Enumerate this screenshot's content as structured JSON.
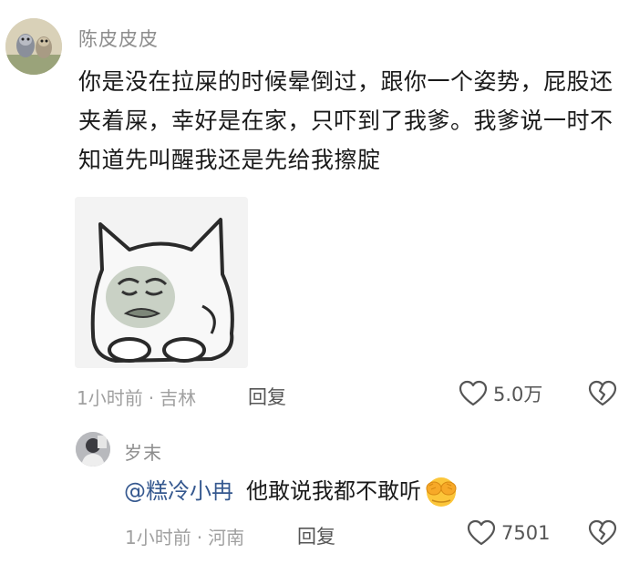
{
  "comment": {
    "username": "陈皮皮皮",
    "text": "你是没在拉屎的时候晕倒过，跟你一个姿势，屁股还夹着屎，幸好是在家，只吓到了我爹。我爹说一时不知道先叫醒我还是先给我擦腚",
    "time": "1小时前",
    "separator": "·",
    "location": "吉林",
    "reply_label": "回复",
    "like_count": "5.0万"
  },
  "reply": {
    "username": "岁末",
    "mention": "@糕冷小冉",
    "text": "他敢说我都不敢听",
    "time": "1小时前",
    "separator": "·",
    "location": "河南",
    "reply_label": "回复",
    "like_count": "7501"
  },
  "icons": {
    "like": "heart-outline-icon",
    "dislike": "broken-heart-icon",
    "emoji": "face-covering-eyes-emoji-icon"
  },
  "colors": {
    "mention": "#35588f",
    "meta_gray": "#a0a0a0",
    "username_gray": "#8d8d8d"
  }
}
